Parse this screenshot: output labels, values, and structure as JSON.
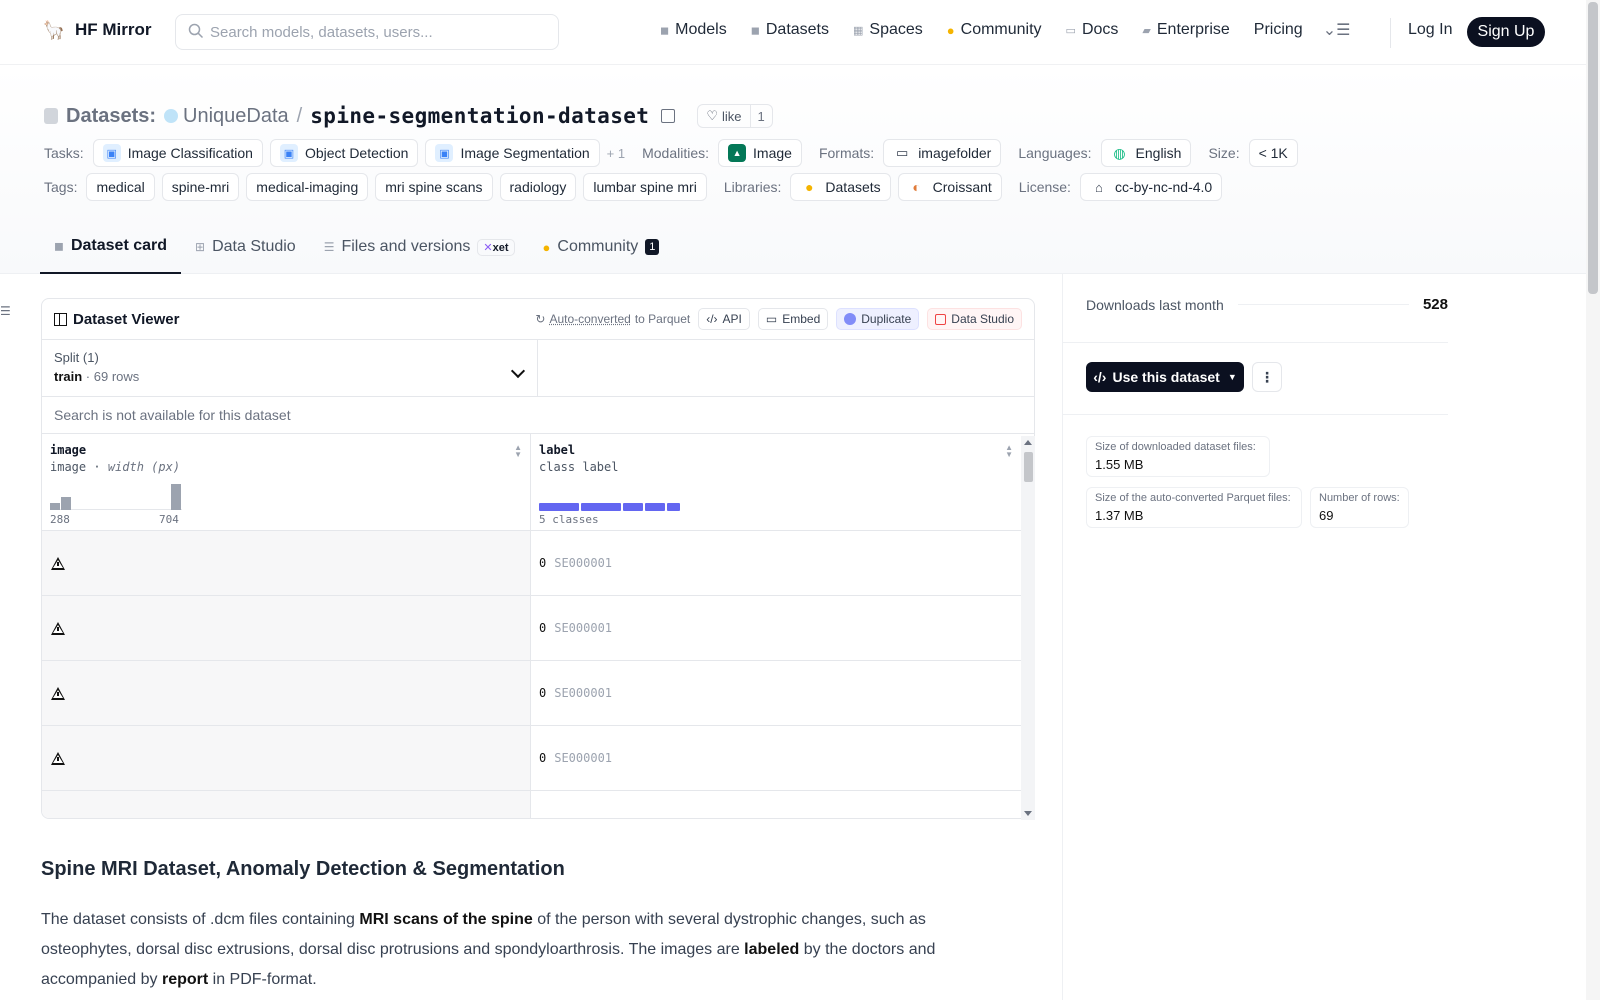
{
  "nav": {
    "brand": "HF Mirror",
    "search_placeholder": "Search models, datasets, users...",
    "links": [
      {
        "label": "Models",
        "icon": "cube-icon"
      },
      {
        "label": "Datasets",
        "icon": "database-icon"
      },
      {
        "label": "Spaces",
        "icon": "grid-icon"
      },
      {
        "label": "Community",
        "icon": "chat-icon"
      },
      {
        "label": "Docs",
        "icon": "book-icon"
      },
      {
        "label": "Enterprise",
        "icon": "briefcase-icon"
      },
      {
        "label": "Pricing",
        "icon": ""
      }
    ],
    "login": "Log In",
    "signup": "Sign Up"
  },
  "header": {
    "section": "Datasets:",
    "org": "UniqueData",
    "separator": "/",
    "name": "spine-segmentation-dataset",
    "like_label": "like",
    "like_count": "1",
    "tasks_key": "Tasks:",
    "tasks": [
      "Image Classification",
      "Object Detection",
      "Image Segmentation"
    ],
    "tasks_more": "+ 1",
    "modalities_key": "Modalities:",
    "modality": "Image",
    "formats_key": "Formats:",
    "format": "imagefolder",
    "languages_key": "Languages:",
    "language": "English",
    "size_key": "Size:",
    "size": "< 1K",
    "tags_key": "Tags:",
    "tags": [
      "medical",
      "spine-mri",
      "medical-imaging",
      "mri spine scans",
      "radiology",
      "lumbar spine mri"
    ],
    "libraries_key": "Libraries:",
    "libraries": [
      "Datasets",
      "Croissant"
    ],
    "license_key": "License:",
    "license": "cc-by-nc-nd-4.0"
  },
  "tabs": [
    {
      "label": "Dataset card"
    },
    {
      "label": "Data Studio"
    },
    {
      "label": "Files and versions"
    },
    {
      "label": "Community",
      "badge": "1"
    }
  ],
  "xet_label": "xet",
  "viewer": {
    "title": "Dataset Viewer",
    "autoconv_link": "Auto-converted",
    "autoconv_rest": "to Parquet",
    "api": "API",
    "embed": "Embed",
    "duplicate": "Duplicate",
    "data_studio": "Data Studio",
    "split_label": "Split (1)",
    "split_name": "train",
    "split_dot": "·",
    "split_rows": "69 rows",
    "search_na": "Search is not available for this dataset",
    "col1": {
      "name": "image",
      "type": "image",
      "dot": "·",
      "desc": "width (px)",
      "hist_min": "288",
      "hist_max": "704",
      "hist_values": [
        1,
        2,
        0,
        0,
        0,
        0,
        0,
        0,
        0,
        0,
        0,
        4
      ]
    },
    "col2": {
      "name": "label",
      "type": "class label",
      "classes": "5 classes",
      "class_proportions": [
        0.3,
        0.3,
        0.15,
        0.15,
        0.1
      ]
    },
    "rows": [
      {
        "label": "0",
        "label_name": "SE000001"
      },
      {
        "label": "0",
        "label_name": "SE000001"
      },
      {
        "label": "0",
        "label_name": "SE000001"
      },
      {
        "label": "0",
        "label_name": "SE000001"
      }
    ]
  },
  "sidebar": {
    "downloads_label": "Downloads last month",
    "downloads": "528",
    "use_button": "Use this dataset",
    "stat_dl_key": "Size of downloaded dataset files:",
    "stat_dl_val": "1.55 MB",
    "stat_pq_key": "Size of the auto-converted Parquet files:",
    "stat_pq_val": "1.37 MB",
    "stat_rows_key": "Number of rows:",
    "stat_rows_val": "69"
  },
  "readme": {
    "title": "Spine MRI Dataset, Anomaly Detection & Segmentation",
    "p1_a": "The dataset consists of .dcm files containing ",
    "p1_b": "MRI scans of the spine",
    "p1_c": " of the person with several dystrophic changes, such as osteophytes, dorsal disc extrusions, dorsal disc protrusions and spondyloarthrosis. The images are ",
    "p1_d": "labeled",
    "p1_e": " by the doctors and accompanied by ",
    "p1_f": "report",
    "p1_g": " in PDF-format."
  }
}
